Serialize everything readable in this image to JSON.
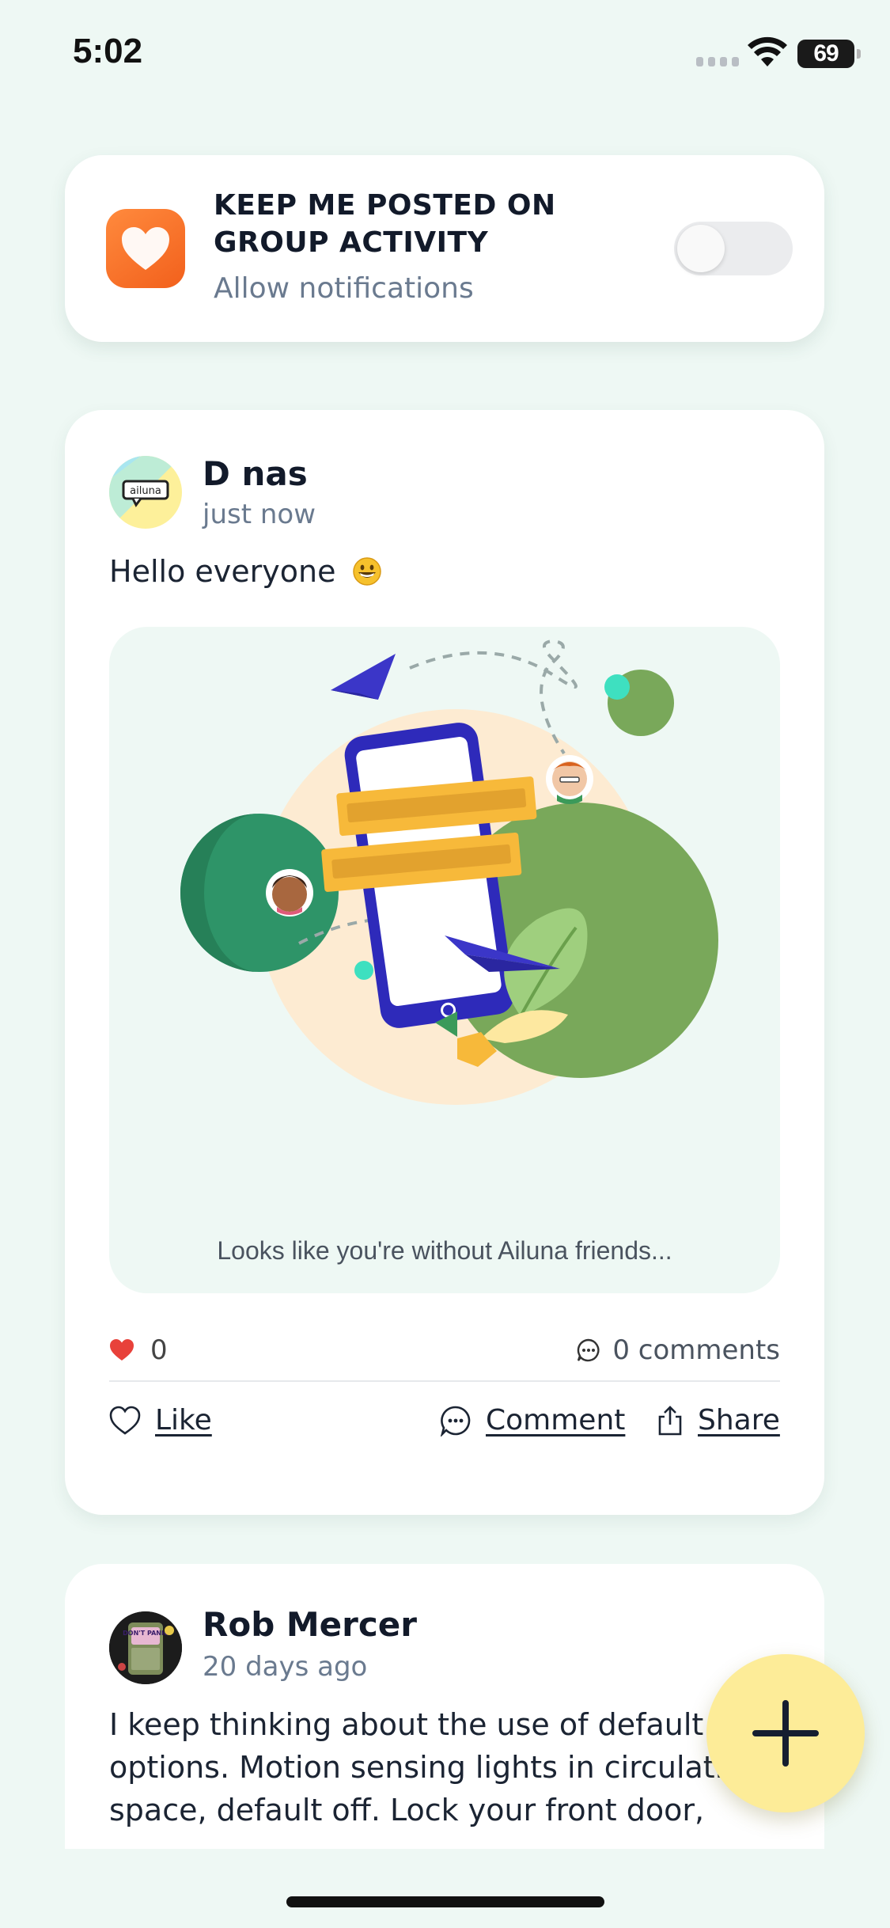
{
  "status_bar": {
    "time": "5:02",
    "battery": "69"
  },
  "notification": {
    "title": "KEEP ME POSTED ON GROUP ACTIVITY",
    "subtitle": "Allow notifications",
    "toggle_on": false,
    "icon": "heart-icon",
    "accent": "#f2601c"
  },
  "posts": [
    {
      "author": "D nas",
      "avatar_text": "ailuna",
      "time": "just now",
      "text": "Hello everyone",
      "emoji": "grinning-face-emoji",
      "image_caption": "Looks like you're without Ailuna friends...",
      "likes": "0",
      "comments": "0 comments",
      "actions": {
        "like": "Like",
        "comment": "Comment",
        "share": "Share"
      }
    },
    {
      "author": "Rob Mercer",
      "avatar_text": "DON'T PANIC",
      "time": "20 days ago",
      "text": "I keep thinking about the use of default options. Motion sensing lights in circulati space, default off. Lock your front door,"
    }
  ],
  "fab": {
    "icon": "plus-icon",
    "color": "#fdec98"
  },
  "colors": {
    "background": "#eef8f4",
    "like_red": "#e8413a",
    "primary_text": "#121a2a",
    "secondary_text": "#6a7a8f"
  }
}
